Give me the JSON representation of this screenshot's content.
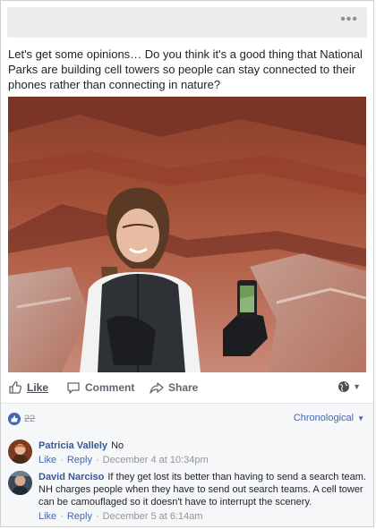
{
  "post": {
    "text": "Let's get some opinions… Do you think it's a good thing that National Parks are building cell towers so people can stay connected to their phones rather than connecting in nature?"
  },
  "actions": {
    "like": "Like",
    "comment": "Comment",
    "share": "Share"
  },
  "feedback": {
    "reaction_count": "22",
    "sort_label": "Chronological"
  },
  "comments": [
    {
      "author": "Patricia Vallely",
      "text": "No",
      "like": "Like",
      "reply": "Reply",
      "time": "December 4 at 10:34pm"
    },
    {
      "author": "David Narciso",
      "text": "If they get lost its better than having to send a search team. NH charges people when they have to send out search teams. A cell tower can be camouflaged so it doesn't have to interrupt the scenery.",
      "like": "Like",
      "reply": "Reply",
      "time": "December 5 at 6:14am"
    }
  ],
  "icons": {
    "more": "more-dots-icon",
    "like": "thumbs-up-icon",
    "comment": "speech-bubble-icon",
    "share": "share-arrow-icon",
    "audience": "globe-icon",
    "reaction": "like-reaction-icon"
  },
  "colors": {
    "link": "#365899",
    "accent": "#4267b2",
    "muted": "#90949c"
  }
}
